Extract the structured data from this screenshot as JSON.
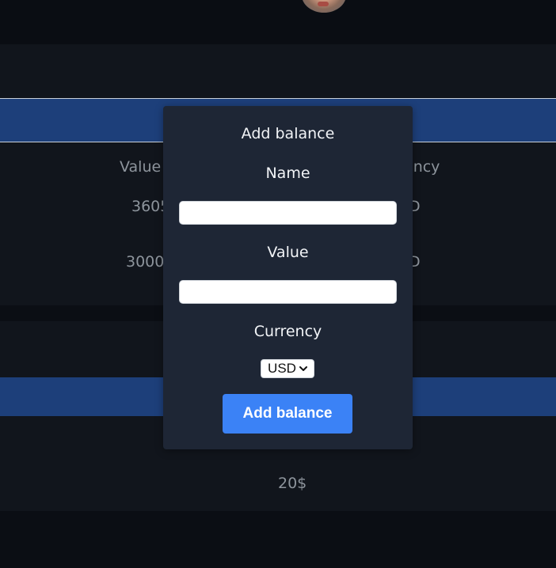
{
  "header": {
    "cropped_text": "·· ··  ·",
    "avatar_alt": "user avatar"
  },
  "background": {
    "section1": {
      "col_value_header": "Value",
      "col_currency_header": "ency",
      "row1_value": "3605",
      "row1_currency": "D",
      "row2_value": "3000",
      "row2_currency": "D"
    },
    "section2": {
      "partial_value": "· · ·",
      "row_value": "20$"
    }
  },
  "modal": {
    "title": "Add balance",
    "name_label": "Name",
    "name_value": "",
    "value_label": "Value",
    "value_value": "",
    "currency_label": "Currency",
    "currency_selected": "USD",
    "submit_label": "Add balance"
  },
  "colors": {
    "modal_bg": "#1e2635",
    "accent": "#3b82f6",
    "table_header_bar": "#1d3f7a",
    "page_bg": "#0b0e14"
  }
}
